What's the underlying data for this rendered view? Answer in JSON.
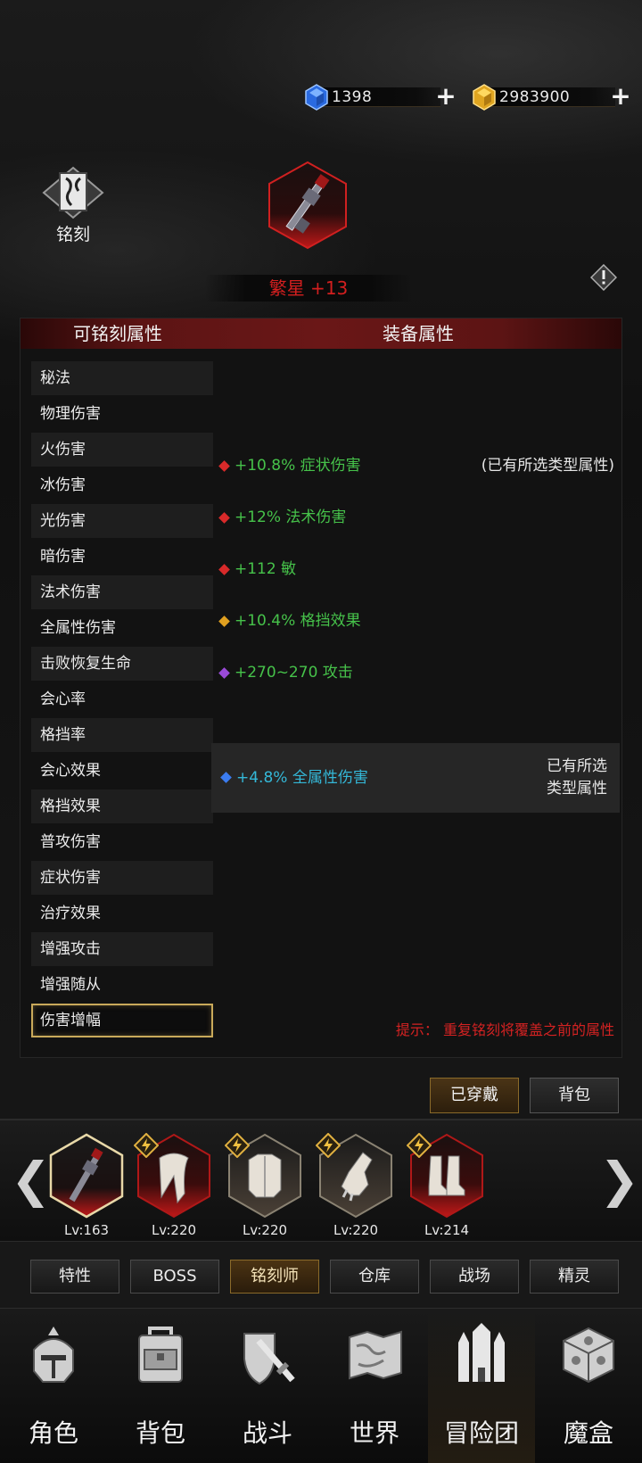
{
  "currency": {
    "gems": "1398",
    "gold": "2983900"
  },
  "engrave": {
    "label": "铭刻"
  },
  "item": {
    "name": "繁星 +13"
  },
  "panel": {
    "left_header": "可铭刻属性",
    "right_header": "装备属性",
    "attributes": [
      "秘法",
      "物理伤害",
      "火伤害",
      "冰伤害",
      "光伤害",
      "暗伤害",
      "法术伤害",
      "全属性伤害",
      "击败恢复生命",
      "会心率",
      "格挡率",
      "会心效果",
      "格挡效果",
      "普攻伤害",
      "症状伤害",
      "治疗效果",
      "增强攻击",
      "增强随从",
      "伤害增幅"
    ],
    "selected_attribute": "伤害增幅",
    "equip_attrs": [
      {
        "text": "+10.8% 症状伤害",
        "note": "(已有所选类型属性)",
        "color": "#d82a2a"
      },
      {
        "text": "+12% 法术伤害",
        "note": "",
        "color": "#d82a2a"
      },
      {
        "text": "+112 敏",
        "note": "",
        "color": "#d82a2a"
      },
      {
        "text": "+10.4% 格挡效果",
        "note": "",
        "color": "#e0a020"
      },
      {
        "text": "+270~270 攻击",
        "note": "",
        "color": "#9a4ad8"
      }
    ],
    "highlight_attr": {
      "text": "+4.8% 全属性伤害",
      "note_line1": "已有所选",
      "note_line2": "类型属性",
      "color": "#3b7cf0"
    },
    "hint": "提示：  重复铭刻将覆盖之前的属性"
  },
  "actions": {
    "equipped": "已穿戴",
    "bag": "背包"
  },
  "carousel": {
    "slots": [
      {
        "lv": "Lv:163",
        "icon": "gun-icon",
        "frame": "gold"
      },
      {
        "lv": "Lv:220",
        "icon": "scarf-icon",
        "frame": "red"
      },
      {
        "lv": "Lv:220",
        "icon": "armor-icon",
        "frame": "gray"
      },
      {
        "lv": "Lv:220",
        "icon": "gauntlet-icon",
        "frame": "gray"
      },
      {
        "lv": "Lv:214",
        "icon": "boots-icon",
        "frame": "red"
      }
    ]
  },
  "tabs": [
    "特性",
    "BOSS",
    "铭刻师",
    "仓库",
    "战场",
    "精灵"
  ],
  "active_tab": "铭刻师",
  "nav": [
    "角色",
    "背包",
    "战斗",
    "世界",
    "冒险团",
    "魔盒"
  ],
  "active_nav": "冒险团"
}
